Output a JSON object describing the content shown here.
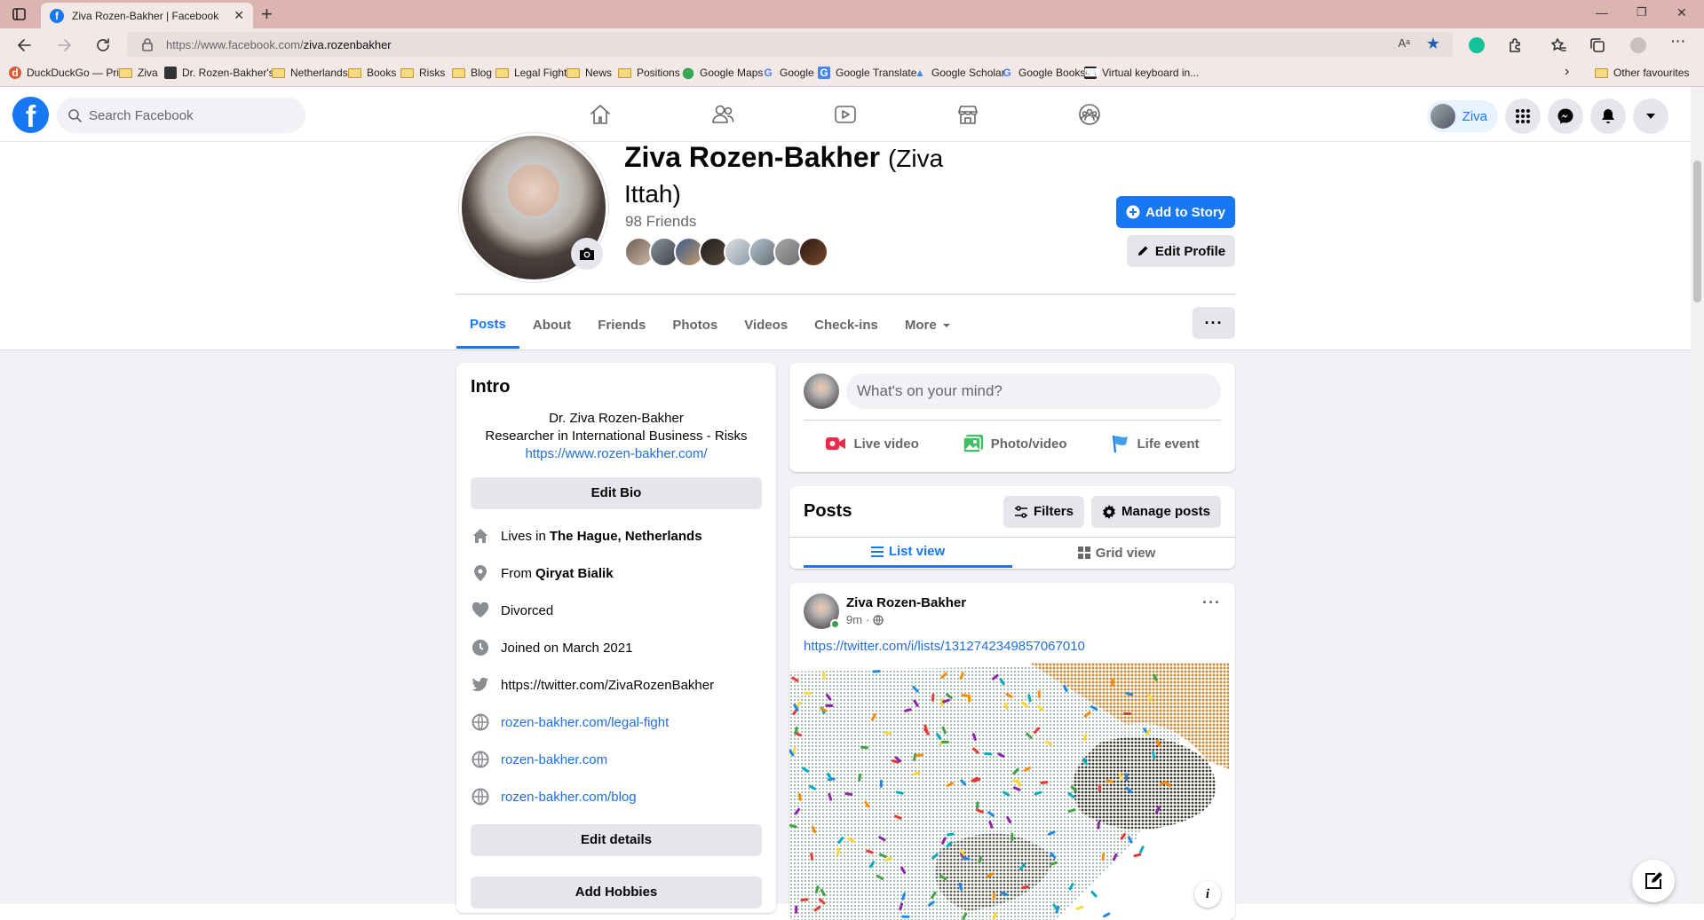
{
  "browser": {
    "tab_title": "Ziva Rozen-Bakher | Facebook",
    "url_base": "https://www.facebook.com/",
    "url_path": "ziva.rozenbakher",
    "bookmarks": [
      {
        "label": "DuckDuckGo — Pri...",
        "icon": "duckduckgo-icon"
      },
      {
        "label": "Ziva",
        "icon": "folder-icon"
      },
      {
        "label": "Dr. Rozen-Bakher's...",
        "icon": "cube-icon"
      },
      {
        "label": "Netherlands",
        "icon": "folder-icon"
      },
      {
        "label": "Books",
        "icon": "folder-icon"
      },
      {
        "label": "Risks",
        "icon": "folder-icon"
      },
      {
        "label": "Blog",
        "icon": "folder-icon"
      },
      {
        "label": "Legal Fight",
        "icon": "folder-icon"
      },
      {
        "label": "News",
        "icon": "folder-icon"
      },
      {
        "label": "Positions",
        "icon": "folder-icon"
      },
      {
        "label": "Google Maps",
        "icon": "maps-pin-icon"
      },
      {
        "label": "Google",
        "icon": "google-icon"
      },
      {
        "label": "Google Translate",
        "icon": "translate-icon"
      },
      {
        "label": "Google Scholar",
        "icon": "scholar-icon"
      },
      {
        "label": "Google Books",
        "icon": "google-icon"
      },
      {
        "label": "Virtual keyboard in...",
        "icon": "keyboard-icon"
      }
    ],
    "other_favourites": "Other favourites"
  },
  "header": {
    "search_placeholder": "Search Facebook",
    "profile_name": "Ziva"
  },
  "profile": {
    "name": "Ziva Rozen-Bakher",
    "alt_name": "(Ziva Ittah)",
    "friends_count": "98 Friends",
    "add_story": "Add to Story",
    "edit_profile": "Edit Profile",
    "tabs": [
      "Posts",
      "About",
      "Friends",
      "Photos",
      "Videos",
      "Check-ins",
      "More"
    ],
    "more_button": "···"
  },
  "intro": {
    "title": "Intro",
    "bio_line1": "Dr. Ziva Rozen-Bakher",
    "bio_line2": "Researcher in International Business - Risks",
    "bio_link": "https://www.rozen-bakher.com/",
    "edit_bio": "Edit Bio",
    "lives_prefix": "Lives in",
    "lives_place": "The Hague, Netherlands",
    "from_prefix": "From",
    "from_place": "Qiryat Bialik",
    "relationship": "Divorced",
    "joined": "Joined on March 2021",
    "twitter": "https://twitter.com/ZivaRozenBakher",
    "link1": "rozen-bakher.com/legal-fight",
    "link2": "rozen-bakher.com",
    "link3": "rozen-bakher.com/blog",
    "edit_details": "Edit details",
    "add_hobbies": "Add Hobbies"
  },
  "composer": {
    "placeholder": "What's on your mind?",
    "live_video": "Live video",
    "photo_video": "Photo/video",
    "life_event": "Life event"
  },
  "posts": {
    "title": "Posts",
    "filters": "Filters",
    "manage": "Manage posts",
    "list_view": "List view",
    "grid_view": "Grid view"
  },
  "post": {
    "author": "Ziva Rozen-Bakher",
    "time": "9m",
    "link": "https://twitter.com/i/lists/1312742349857067010",
    "menu": "···",
    "info": "i"
  },
  "colors": {
    "accent": "#1877f2",
    "tabbar": "#dcb5b3",
    "chrome": "#f3e8e8",
    "page_bg": "#f0f2f5"
  }
}
